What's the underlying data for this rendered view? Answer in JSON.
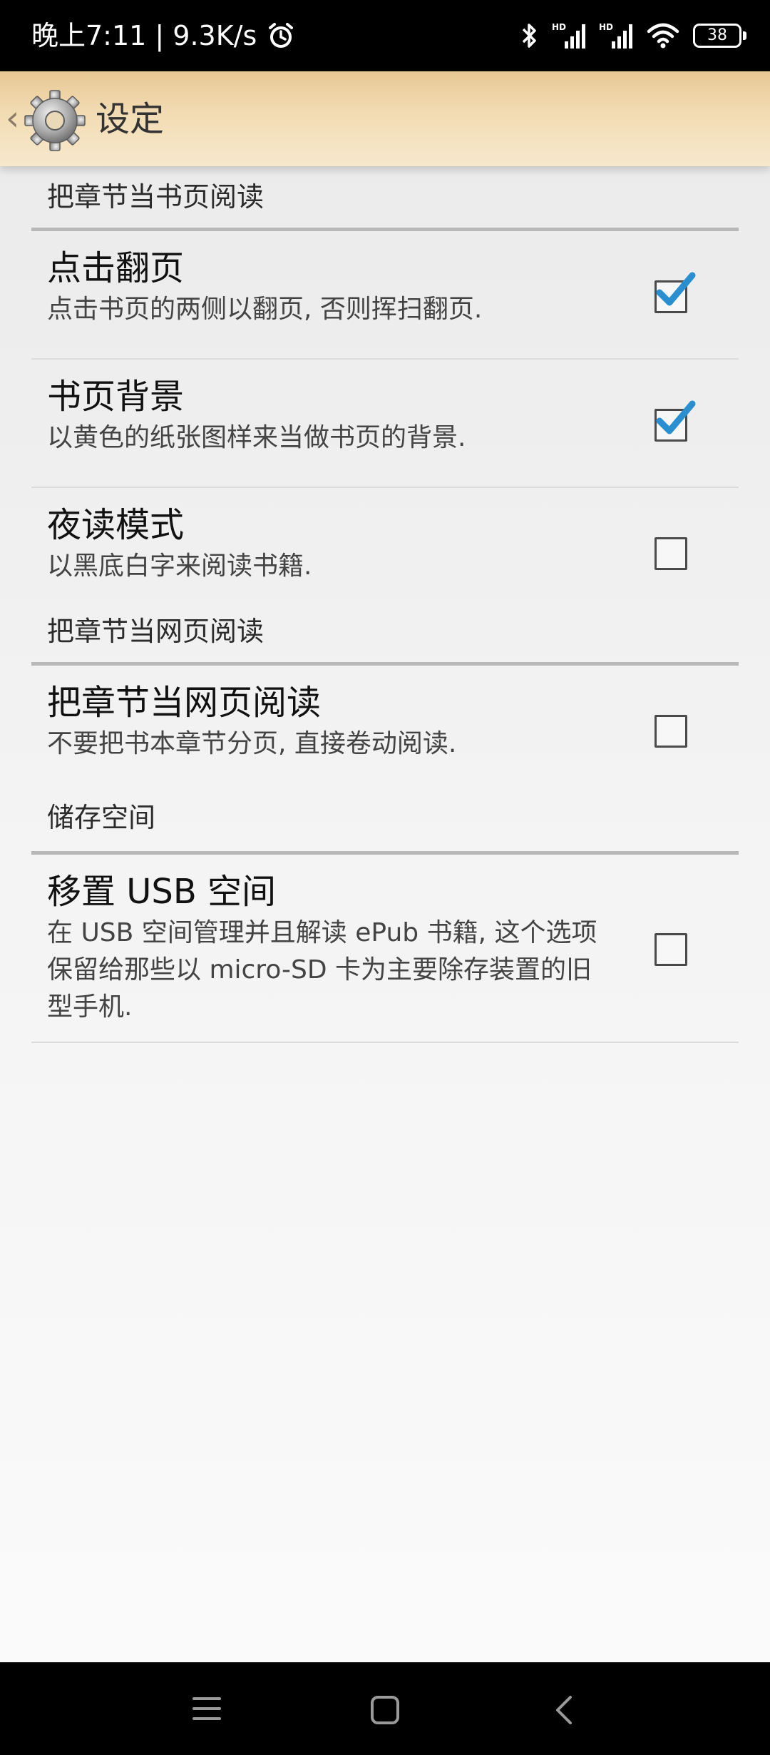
{
  "status_bar": {
    "time_speed": "晚上7:11 | 9.3K/s",
    "battery": "38"
  },
  "title_bar": {
    "title": "设定"
  },
  "sections": [
    {
      "header": "把章节当书页阅读",
      "items": [
        {
          "title": "点击翻页",
          "summary": "点击书页的两侧以翻页, 否则挥扫翻页.",
          "checked": true
        },
        {
          "title": "书页背景",
          "summary": "以黄色的纸张图样来当做书页的背景.",
          "checked": true
        },
        {
          "title": "夜读模式",
          "summary": "以黑底白字来阅读书籍.",
          "checked": false
        }
      ]
    },
    {
      "header": "把章节当网页阅读",
      "items": [
        {
          "title": "把章节当网页阅读",
          "summary": "不要把书本章节分页, 直接卷动阅读.",
          "checked": false
        }
      ]
    },
    {
      "header": "储存空间",
      "items": [
        {
          "title": "移置 USB 空间",
          "summary": "在 USB 空间管理并且解读 ePub 书籍, 这个选项保留给那些以 micro-SD 卡为主要除存装置的旧型手机.",
          "checked": false
        }
      ]
    }
  ],
  "colors": {
    "title_bar": "#f0d8ac",
    "check_blue": "#2a8fd0"
  }
}
